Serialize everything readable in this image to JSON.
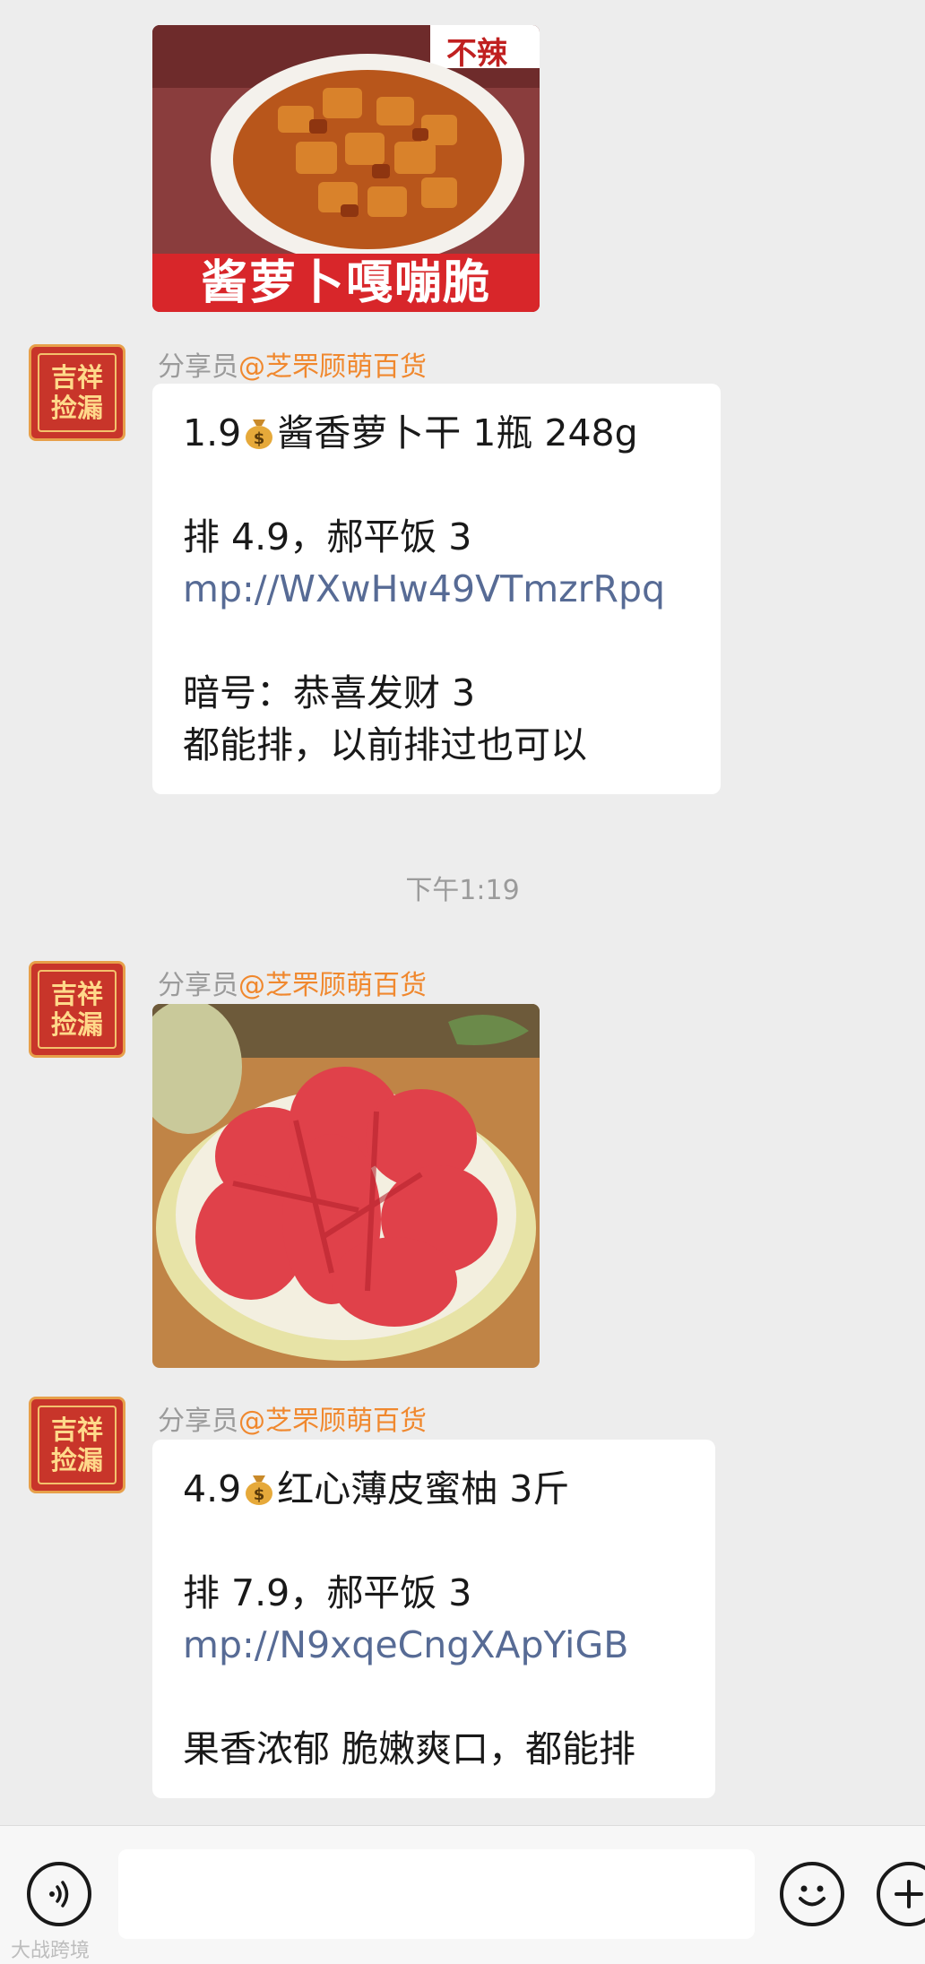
{
  "messages": [
    {
      "image_caption": "酱萝卜嘎嘣脆",
      "image_tag": "不辣",
      "image_label": "酱萝卜"
    },
    {
      "sender_prefix": "分享员",
      "sender_handle": "@芝罘顾萌百货",
      "lines": [
        "1.9",
        "酱香萝卜干 1瓶 248g",
        "排 4.9，郝平饭 3",
        "mp://WXwHw49VTmzrRpq",
        "暗号：恭喜发财 3",
        "都能排，以前排过也可以"
      ]
    },
    {
      "timestamp": "下午1:19"
    },
    {
      "sender_prefix": "分享员",
      "sender_handle": "@芝罘顾萌百货"
    },
    {
      "sender_prefix": "分享员",
      "sender_handle": "@芝罘顾萌百货",
      "lines": [
        "4.9",
        "红心薄皮蜜柚 3斤",
        "排 7.9，郝平饭 3",
        "mp://N9xqeCngXApYiGB",
        "果香浓郁 脆嫩爽口，都能排"
      ]
    }
  ],
  "avatar": {
    "line1": "吉祥",
    "line2": "捡漏"
  },
  "icons": {
    "money": "money-bag-icon",
    "voice": "voice-icon",
    "emoji": "emoji-icon",
    "plus": "plus-icon"
  },
  "colors": {
    "link": "#576b95",
    "handle": "#f0882e",
    "background": "#ededed"
  },
  "watermark": "大战跨境"
}
